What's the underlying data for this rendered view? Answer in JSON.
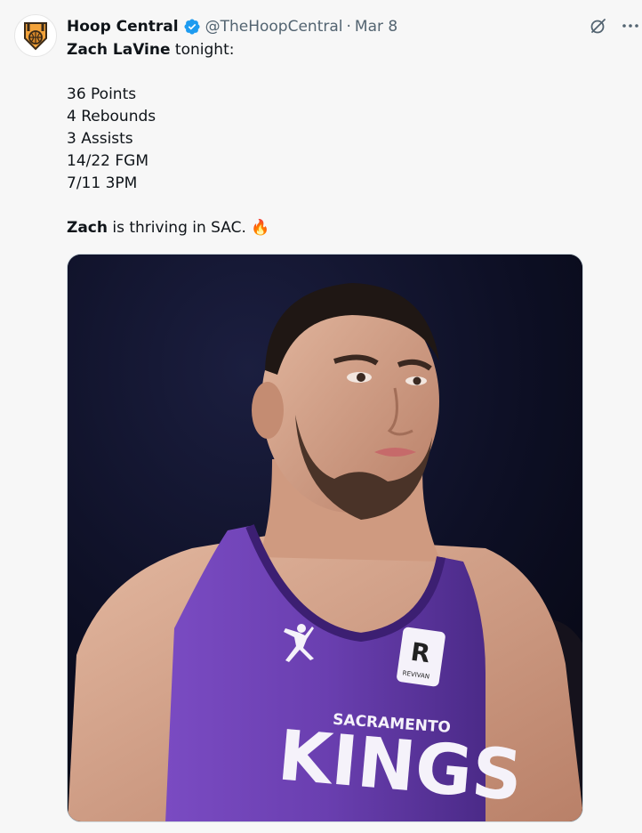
{
  "author": {
    "display_name": "Hoop Central",
    "handle": "@TheHoopCentral",
    "separator": "·",
    "date": "Mar 8"
  },
  "tweet": {
    "line1_name": "Zach LaVine",
    "line1_rest": " tonight:",
    "stats": [
      "36 Points",
      "4 Rebounds",
      "3 Assists",
      "14/22 FGM",
      "7/11 3PM"
    ],
    "closing_name": "Zach",
    "closing_rest": " is thriving in SAC.",
    "closing_emoji": "🔥"
  },
  "media": {
    "jersey_city": "SACRAMENTO",
    "jersey_team": "KINGS",
    "sponsor_letter": "R",
    "sponsor_name": "REVIVAN"
  },
  "icons": {
    "avatar": "hoop-central-logo-icon",
    "verified": "verified-badge-icon",
    "grok": "grok-icon",
    "more": "more-options-icon"
  },
  "colors": {
    "verified_blue": "#1d9bf0",
    "text_primary": "#0f1419",
    "text_secondary": "#536471",
    "jersey_purple": "#6a3fb0",
    "background": "#f7f7f7"
  }
}
